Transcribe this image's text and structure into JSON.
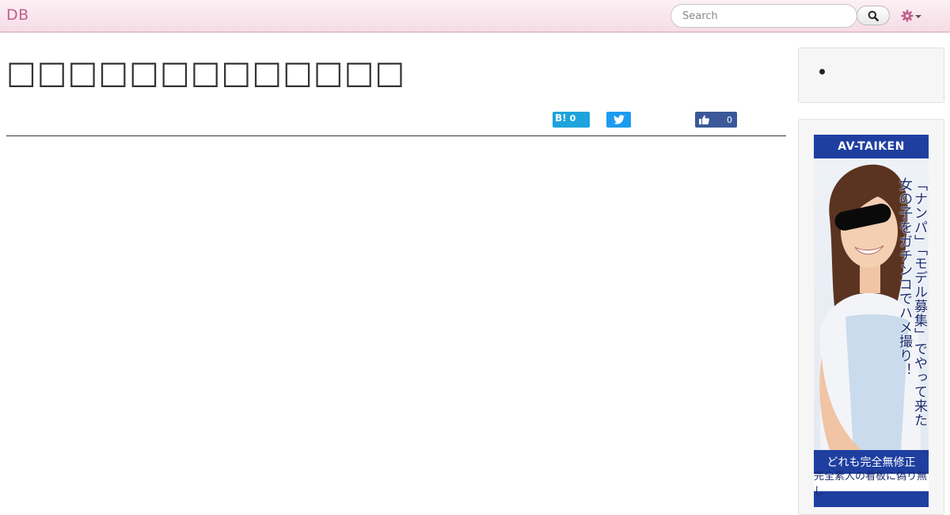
{
  "navbar": {
    "brand": "DB",
    "search": {
      "placeholder": "Search",
      "value": ""
    },
    "search_button_icon": "search-icon",
    "settings_icon": "gear-icon",
    "accent": "#c0608a"
  },
  "main": {
    "title": "□□□□□□□□□□□□□",
    "share": {
      "hatena_label": "B!",
      "hatena_count": "0",
      "twitter_icon": "twitter-bird-icon",
      "facebook_icon": "thumbs-up-icon",
      "facebook_count": "0"
    }
  },
  "sidebar": {
    "ad": {
      "logo": "AV-TAIKEN",
      "headline": "「ナンパ」「モデル募集」でやって来た\n女の子をガチンコでハメ撮り！",
      "line1": "どれも完全無修正",
      "line2": "完全素人の看板に偽り無し"
    }
  }
}
